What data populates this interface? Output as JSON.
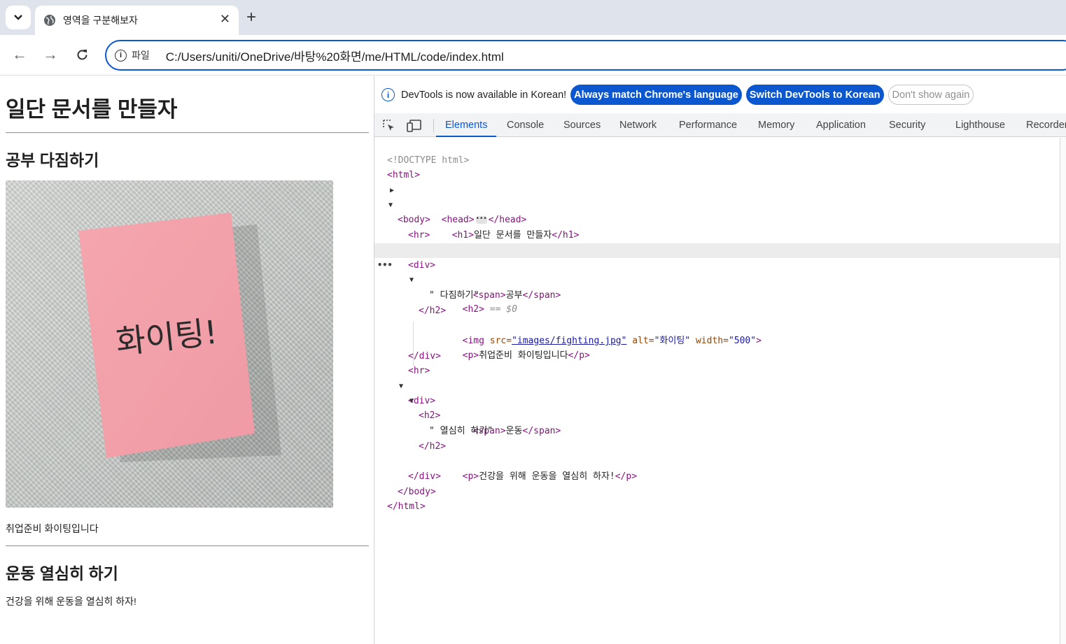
{
  "browser": {
    "tab_title": "영역을 구분해보자",
    "address_label": "파일",
    "url": "C:/Users/uniti/OneDrive/바탕%20화면/me/HTML/code/index.html"
  },
  "page": {
    "h1": "일단 문서를 만들자",
    "section1_heading": "공부 다짐하기",
    "image_text": "화이팅!",
    "section1_paragraph": "취업준비 화이팅입니다",
    "section2_heading": "운동 열심히 하기",
    "section2_paragraph": "건강을 위해 운동을 열심히 하자!"
  },
  "devtools": {
    "info_text": "DevTools is now available in Korean!",
    "btn_match": "Always match Chrome's language",
    "btn_switch": "Switch DevTools to Korean",
    "btn_dont_show": "Don't show again",
    "tabs": [
      "Elements",
      "Console",
      "Sources",
      "Network",
      "Performance",
      "Memory",
      "Application",
      "Security",
      "Lighthouse",
      "Recorder"
    ],
    "code": {
      "doctype": "<!DOCTYPE html>",
      "html_open": "<html>",
      "head_open": "<head>",
      "head_close": "</head>",
      "body_open": "<body>",
      "h1_open": "<h1>",
      "h1_text": "일단 문서를 만들자",
      "h1_close": "</h1>",
      "hr": "<hr>",
      "div_open": "<div>",
      "h2_open": "<h2>",
      "h2_marker": " == $0",
      "span_open": "<span>",
      "span1_text": "공부",
      "span_close": "</span>",
      "h2_1_text": "\" 다짐하기\"",
      "h2_close": "</h2>",
      "img_open": "<img",
      "attr_src": " src=",
      "val_src": "\"images/fighting.jpg\"",
      "attr_alt": " alt=",
      "val_alt": "\"화이팅\"",
      "attr_width": " width=",
      "val_width": "\"500\"",
      "img_end": ">",
      "p_open": "<p>",
      "p1_text": "취업준비 화이팅입니다",
      "p_close": "</p>",
      "div_close": "</div>",
      "span2_text": "운동",
      "h2_2_text": "\" 열심히 하기\"",
      "p2_text": "건강을 위해 운동을 열심히 하자!",
      "body_close": "</body>",
      "html_close": "</html>"
    }
  }
}
